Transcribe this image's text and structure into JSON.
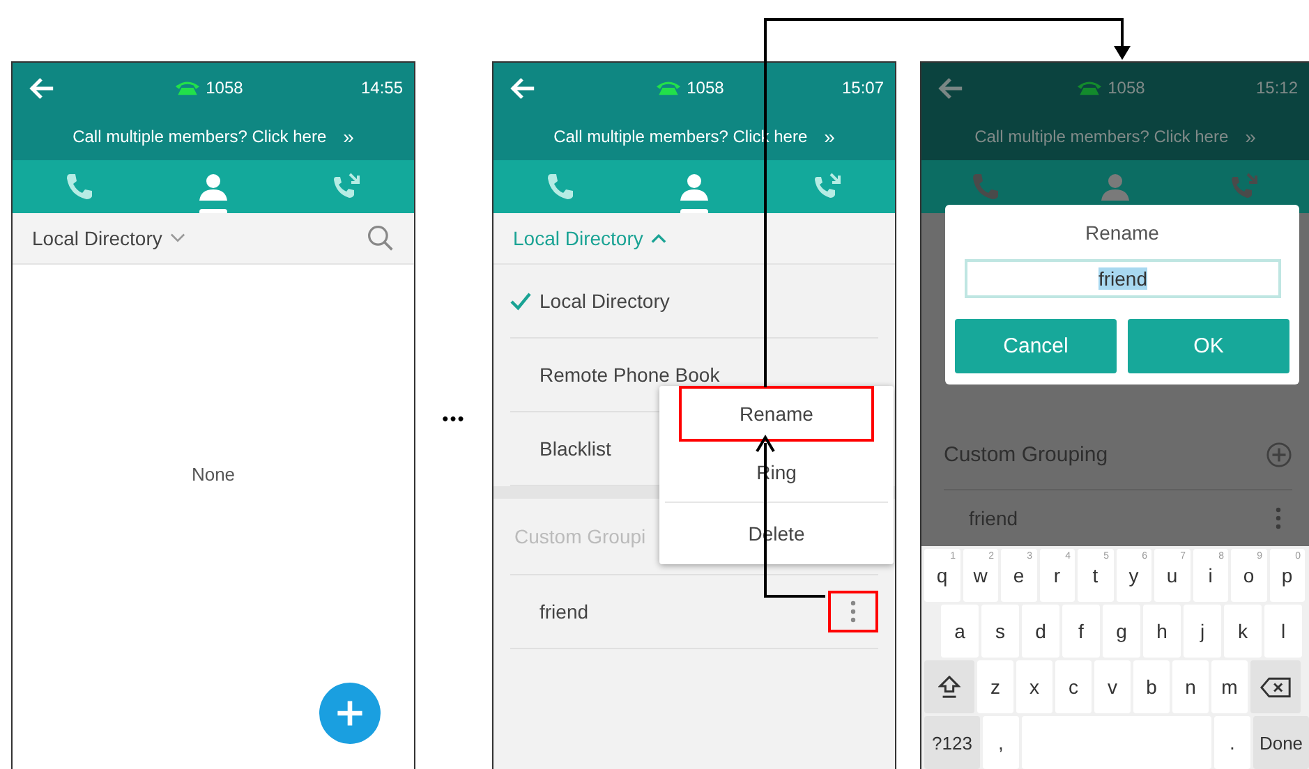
{
  "screens": [
    {
      "kind": "directory",
      "dimmed": false,
      "status": {
        "line": "1058",
        "time": "14:55"
      },
      "banner": {
        "text": "Call multiple members? Click here",
        "chevron": "»"
      },
      "tabs": [
        {
          "kind": "calls",
          "selected": false
        },
        {
          "kind": "contacts",
          "selected": true
        },
        {
          "kind": "history",
          "selected": false
        }
      ],
      "filter": {
        "label": "Local Directory",
        "expanded": false
      },
      "empty_text": "None"
    },
    {
      "kind": "directory_menu",
      "dimmed": false,
      "status": {
        "line": "1058",
        "time": "15:07"
      },
      "banner": {
        "text": "Call multiple members? Click here",
        "chevron": "»"
      },
      "tabs": [
        {
          "kind": "calls",
          "selected": false
        },
        {
          "kind": "contacts",
          "selected": true
        },
        {
          "kind": "history",
          "selected": false
        }
      ],
      "filter": {
        "label": "Local Directory",
        "expanded": true
      },
      "sources": [
        {
          "label": "Local Directory",
          "checked": true
        },
        {
          "label": "Remote Phone Book",
          "checked": false
        },
        {
          "label": "Blacklist",
          "checked": false
        }
      ],
      "group_header": "Custom Groupi",
      "groups": [
        {
          "name": "friend",
          "menu_highlighted": true
        }
      ],
      "menu": [
        {
          "label": "Rename",
          "highlighted": true
        },
        {
          "label": "Ring",
          "highlighted": false
        },
        {
          "label": "Delete",
          "highlighted": false
        }
      ]
    },
    {
      "kind": "rename_dialog",
      "dimmed": true,
      "status": {
        "line": "1058",
        "time": "15:12"
      },
      "banner": {
        "text": "Call multiple members? Click here",
        "chevron": "»"
      },
      "tabs": [
        {
          "kind": "calls",
          "selected": false
        },
        {
          "kind": "contacts",
          "selected": true
        },
        {
          "kind": "history",
          "selected": false
        }
      ],
      "group_header": "Custom Grouping",
      "groups": [
        {
          "name": "friend",
          "menu_highlighted": false
        }
      ],
      "dialog": {
        "title": "Rename",
        "value": "friend",
        "value_selected": true,
        "buttons": [
          "Cancel",
          "OK"
        ]
      },
      "keyboard": [
        [
          {
            "kind": "char",
            "label": "q",
            "hint": "1"
          },
          {
            "kind": "char",
            "label": "w",
            "hint": "2"
          },
          {
            "kind": "char",
            "label": "e",
            "hint": "3"
          },
          {
            "kind": "char",
            "label": "r",
            "hint": "4"
          },
          {
            "kind": "char",
            "label": "t",
            "hint": "5"
          },
          {
            "kind": "char",
            "label": "y",
            "hint": "6"
          },
          {
            "kind": "char",
            "label": "u",
            "hint": "7"
          },
          {
            "kind": "char",
            "label": "i",
            "hint": "8"
          },
          {
            "kind": "char",
            "label": "o",
            "hint": "9"
          },
          {
            "kind": "char",
            "label": "p",
            "hint": "0"
          }
        ],
        [
          {
            "kind": "char",
            "label": "a"
          },
          {
            "kind": "char",
            "label": "s"
          },
          {
            "kind": "char",
            "label": "d"
          },
          {
            "kind": "char",
            "label": "f"
          },
          {
            "kind": "char",
            "label": "g"
          },
          {
            "kind": "char",
            "label": "h"
          },
          {
            "kind": "char",
            "label": "j"
          },
          {
            "kind": "char",
            "label": "k"
          },
          {
            "kind": "char",
            "label": "l"
          }
        ],
        [
          {
            "kind": "shift"
          },
          {
            "kind": "char",
            "label": "z"
          },
          {
            "kind": "char",
            "label": "x"
          },
          {
            "kind": "char",
            "label": "c"
          },
          {
            "kind": "char",
            "label": "v"
          },
          {
            "kind": "char",
            "label": "b"
          },
          {
            "kind": "char",
            "label": "n"
          },
          {
            "kind": "char",
            "label": "m"
          },
          {
            "kind": "backspace"
          }
        ],
        [
          {
            "kind": "function",
            "label": "?123"
          },
          {
            "kind": "char",
            "label": ","
          },
          {
            "kind": "space"
          },
          {
            "kind": "char",
            "label": "."
          },
          {
            "kind": "function",
            "label": "Done"
          }
        ]
      ]
    }
  ],
  "separator": "•••"
}
